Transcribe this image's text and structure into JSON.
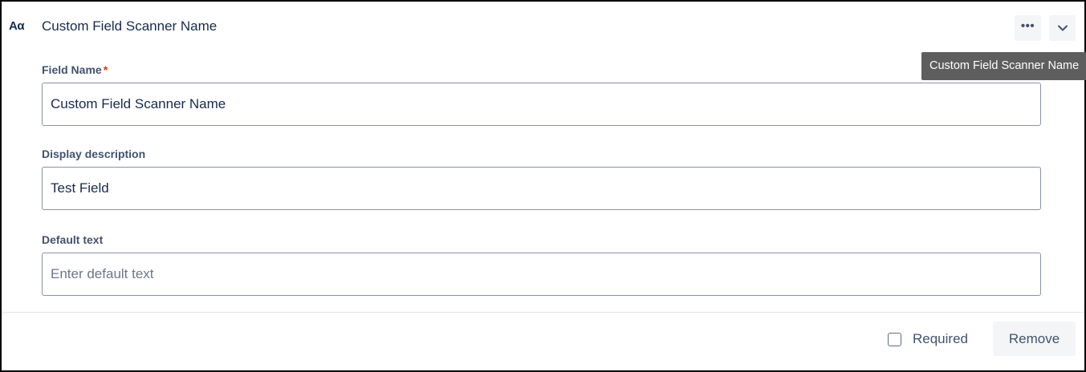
{
  "header": {
    "type_icon": "Aα",
    "title": "Custom Field Scanner Name",
    "more_label": "•••"
  },
  "tooltip": {
    "text": "Custom Field Scanner Name"
  },
  "fields": {
    "field_name": {
      "label": "Field Name",
      "required_mark": "*",
      "value": "Custom Field Scanner Name"
    },
    "display_description": {
      "label": "Display description",
      "value": "Test Field"
    },
    "default_text": {
      "label": "Default text",
      "placeholder": "Enter default text"
    }
  },
  "footer": {
    "required_label": "Required",
    "required_checked": false,
    "remove_label": "Remove"
  }
}
